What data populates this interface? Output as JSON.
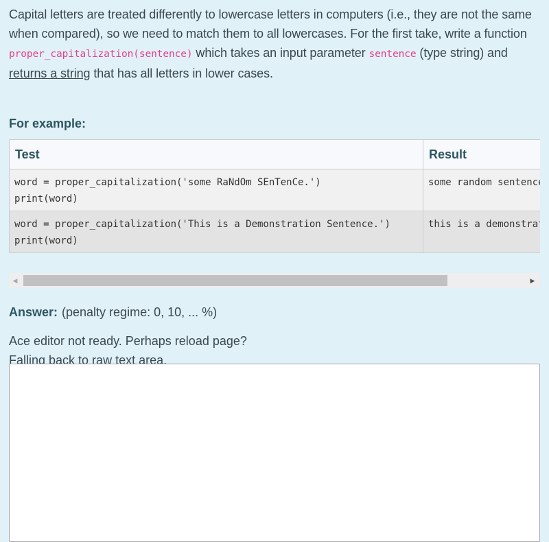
{
  "question": {
    "text_1": "Capital letters are treated differently to lowercase letters in computers (i.e., they are not the same when compared), so we need to match them to all lowercases. For the first take, write a function ",
    "func_signature": "proper_capitalization(sentence)",
    "text_2": " which takes an input parameter ",
    "param_name": "sentence",
    "text_3": " (type string) and ",
    "returns_text": "returns a string",
    "text_4": " that has all letters in lower cases."
  },
  "example": {
    "heading": "For example:",
    "columns": [
      "Test",
      "Result"
    ],
    "rows": [
      {
        "test_lines": [
          "word = proper_capitalization('some RaNdOm SEnTenCe.')",
          "print(word)"
        ],
        "result": "some random sentence."
      },
      {
        "test_lines": [
          "word = proper_capitalization('This is a Demonstration Sentence.')",
          "print(word)"
        ],
        "result": "this is a demonstration sentence."
      }
    ]
  },
  "answer": {
    "label": "Answer:",
    "penalty": "(penalty regime: 0, 10, ... %)",
    "notice_line_1": "Ace editor not ready. Perhaps reload page?",
    "notice_line_2": "Falling back to raw text area.",
    "value": ""
  },
  "icons": {
    "scroll_left": "triangle-left",
    "scroll_right": "triangle-right"
  },
  "colors": {
    "background": "#e0f1f7",
    "code_pink": "#e83e8c",
    "heading": "#2d5561"
  }
}
